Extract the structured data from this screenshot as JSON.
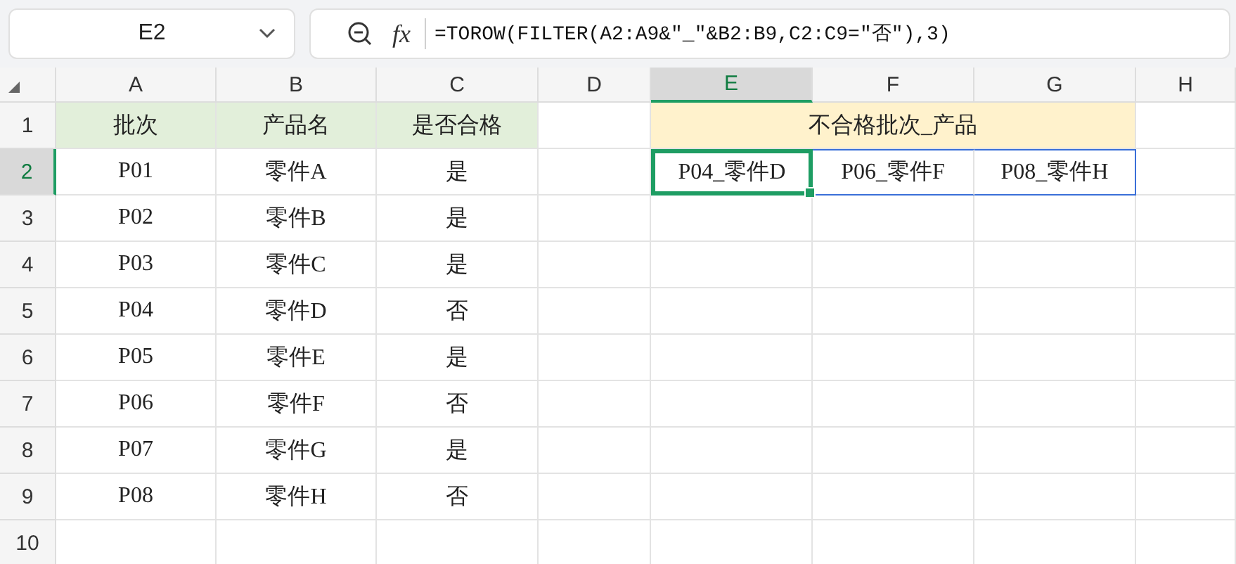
{
  "name_box": {
    "value": "E2"
  },
  "formula_bar": {
    "function_label": "fx",
    "formula": "=TOROW(FILTER(A2:A9&\"_\"&B2:B9,C2:C9=\"否\"),3)"
  },
  "columns": [
    {
      "label": "A",
      "selected": false
    },
    {
      "label": "B",
      "selected": false
    },
    {
      "label": "C",
      "selected": false
    },
    {
      "label": "D",
      "selected": false
    },
    {
      "label": "E",
      "selected": true
    },
    {
      "label": "F",
      "selected": false
    },
    {
      "label": "G",
      "selected": false
    },
    {
      "label": "H",
      "selected": false
    }
  ],
  "rows": [
    {
      "number": "1",
      "selected": false,
      "cells": [
        {
          "kind": "header",
          "text": "批次"
        },
        {
          "kind": "header",
          "text": "产品名"
        },
        {
          "kind": "header",
          "text": "是否合格"
        },
        {
          "kind": "empty"
        },
        {
          "kind": "merged-header",
          "text": "不合格批次_产品"
        },
        {
          "kind": "empty"
        }
      ]
    },
    {
      "number": "2",
      "selected": true,
      "cells": [
        {
          "kind": "plain",
          "text": "P01"
        },
        {
          "kind": "plain",
          "text": "零件A"
        },
        {
          "kind": "plain",
          "text": "是"
        },
        {
          "kind": "empty"
        },
        {
          "kind": "active",
          "text": "P04_零件D"
        },
        {
          "kind": "spill",
          "text": "P06_零件F"
        },
        {
          "kind": "spill",
          "text": "P08_零件H"
        },
        {
          "kind": "empty"
        }
      ]
    },
    {
      "number": "3",
      "selected": false,
      "cells": [
        {
          "kind": "plain",
          "text": "P02"
        },
        {
          "kind": "plain",
          "text": "零件B"
        },
        {
          "kind": "plain",
          "text": "是"
        }
      ]
    },
    {
      "number": "4",
      "selected": false,
      "cells": [
        {
          "kind": "plain",
          "text": "P03"
        },
        {
          "kind": "plain",
          "text": "零件C"
        },
        {
          "kind": "plain",
          "text": "是"
        }
      ]
    },
    {
      "number": "5",
      "selected": false,
      "cells": [
        {
          "kind": "plain",
          "text": "P04"
        },
        {
          "kind": "plain",
          "text": "零件D"
        },
        {
          "kind": "plain",
          "text": "否"
        }
      ]
    },
    {
      "number": "6",
      "selected": false,
      "cells": [
        {
          "kind": "plain",
          "text": "P05"
        },
        {
          "kind": "plain",
          "text": "零件E"
        },
        {
          "kind": "plain",
          "text": "是"
        }
      ]
    },
    {
      "number": "7",
      "selected": false,
      "cells": [
        {
          "kind": "plain",
          "text": "P06"
        },
        {
          "kind": "plain",
          "text": "零件F"
        },
        {
          "kind": "plain",
          "text": "否"
        }
      ]
    },
    {
      "number": "8",
      "selected": false,
      "cells": [
        {
          "kind": "plain",
          "text": "P07"
        },
        {
          "kind": "plain",
          "text": "零件G"
        },
        {
          "kind": "plain",
          "text": "是"
        }
      ]
    },
    {
      "number": "9",
      "selected": false,
      "cells": [
        {
          "kind": "plain",
          "text": "P08"
        },
        {
          "kind": "plain",
          "text": "零件H"
        },
        {
          "kind": "plain",
          "text": "否"
        }
      ]
    },
    {
      "number": "10",
      "selected": false,
      "cells": []
    }
  ]
}
